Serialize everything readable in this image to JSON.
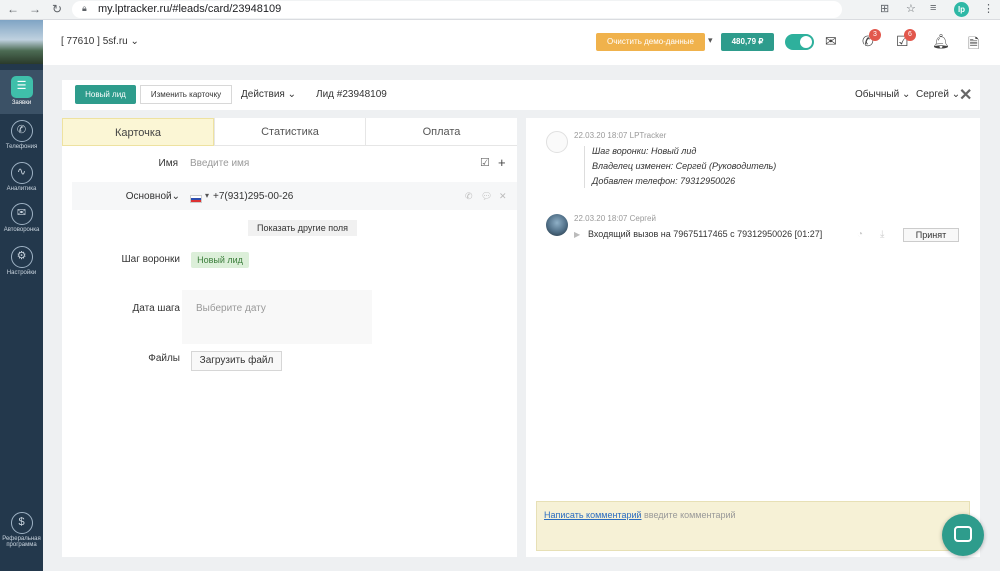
{
  "browser": {
    "url": "my.lptracker.ru/#leads/card/23948109",
    "ext_label": "lp"
  },
  "sidebar": {
    "items": [
      {
        "label": "Заявки",
        "icon": "list-icon"
      },
      {
        "label": "Телефония",
        "icon": "phone-circle-icon"
      },
      {
        "label": "Аналитика",
        "icon": "chart-icon"
      },
      {
        "label": "Автоворонка",
        "icon": "envelope-icon"
      },
      {
        "label": "Настройки",
        "icon": "wrench-icon"
      },
      {
        "label": "Реферальная программа",
        "icon": "dollar-icon"
      }
    ]
  },
  "header": {
    "company": "[ 77610 ] 5sf.ru",
    "demo_button": "Очистить демо-данные",
    "balance": "480,79 ₽",
    "phone_badge": "3",
    "tasks_badge": "6"
  },
  "actionbar": {
    "new_lead": "Новый лид",
    "edit_card": "Изменить карточку",
    "actions": "Действия",
    "lead_id": "Лид #23948109",
    "mode": "Обычный",
    "user": "Сергей"
  },
  "tabs": [
    {
      "label": "Карточка"
    },
    {
      "label": "Статистика"
    },
    {
      "label": "Оплата"
    }
  ],
  "form": {
    "name_label": "Имя",
    "name_placeholder": "Введите имя",
    "phone_type": "Основной",
    "phone_value": "+7(931)295-00-26",
    "show_fields": "Показать другие поля",
    "funnel_label": "Шаг воронки",
    "funnel_value": "Новый лид",
    "date_label": "Дата шага",
    "date_placeholder": "Выберите дату",
    "files_label": "Файлы",
    "upload_button": "Загрузить файл"
  },
  "feed": [
    {
      "time": "22.03.20 18:07",
      "author": "LPTracker",
      "lines": [
        "Шаг воронки: Новый лид",
        "Владелец изменен: Сергей (Руководитель)",
        "Добавлен телефон: 79312950026"
      ]
    },
    {
      "time": "22.03.20 18:07",
      "author": "Сергей",
      "text": "Входящий вызов на 79675117465 с 79312950026 [01:27]",
      "button": "Принят"
    }
  ],
  "comment": {
    "link": "Написать комментарий",
    "placeholder": ": введите комментарий"
  }
}
